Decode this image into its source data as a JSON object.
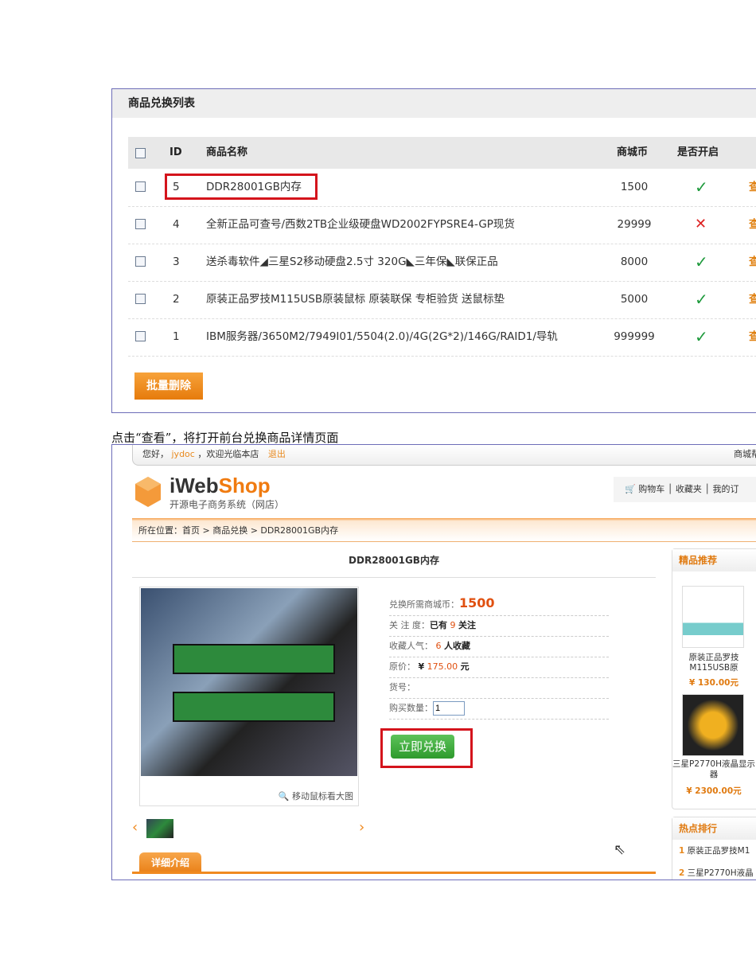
{
  "list_panel": {
    "title": "商品兑换列表",
    "columns": [
      "ID",
      "商品名称",
      "商城币",
      "是否开启"
    ],
    "rows": [
      {
        "id": "5",
        "name": "DDR28001GB内存",
        "coins": "1500",
        "enabled": true,
        "action": "查"
      },
      {
        "id": "4",
        "name": "全新正品可查号/西数2TB企业级硬盘WD2002FYPSRE4-GP现货",
        "coins": "29999",
        "enabled": false,
        "action": "查"
      },
      {
        "id": "3",
        "name": "送杀毒软件◢三星S2移动硬盘2.5寸 320G◣三年保◣联保正品",
        "coins": "8000",
        "enabled": true,
        "action": "查"
      },
      {
        "id": "2",
        "name": "原装正品罗技M115USB原装鼠标 原装联保 专柜验货 送鼠标垫",
        "coins": "5000",
        "enabled": true,
        "action": "查"
      },
      {
        "id": "1",
        "name": "IBM服务器/3650M2/7949I01/5504(2.0)/4G(2G*2)/146G/RAID1/导轨",
        "coins": "999999",
        "enabled": true,
        "action": "查"
      }
    ],
    "enabled_mark": "✓",
    "disabled_mark": "✕",
    "batch_delete": "批量删除"
  },
  "caption": "点击“查看”，将打开前台兑换商品详情页面",
  "shop": {
    "topbar": {
      "greeting": "您好，",
      "user": "jydoc",
      "welcome": "，欢迎光临本店",
      "logout": "退出",
      "right": "商城帮"
    },
    "brand_a": "iWeb",
    "brand_b": "Shop",
    "subtitle": "开源电子商务系统（网店）",
    "nav": [
      "购物车",
      "收藏夹",
      "我的订"
    ],
    "breadcrumb": "所在位置：首页 > 商品兑换 > DDR28001GB内存",
    "product_title": "DDR28001GB内存",
    "zoom_hint": "🔍 移动鼠标看大图",
    "info": {
      "coins_label": "兑换所需商城币：",
      "coins": "1500",
      "follow_label": "关 注 度：",
      "follow_pre": "已有",
      "follow": "9",
      "follow_post": "关注",
      "fav_label": "收藏人气：",
      "fav": "6",
      "fav_post": "人收藏",
      "price_label": "原价：",
      "currency": "¥",
      "price": "175.00",
      "unit": "元",
      "sku_label": "货号：",
      "qty_label": "购买数量：",
      "qty": "1"
    },
    "redeem": "立即兑换",
    "detail_tab": "详细介绍",
    "recommend": {
      "title": "精品推荐",
      "items": [
        {
          "name": "原装正品罗技M115USB原",
          "price": "¥ 130.00元"
        },
        {
          "name": "三星P2770H液晶显示器",
          "price": "¥ 2300.00元"
        }
      ]
    },
    "hot": {
      "title": "热点排行",
      "items": [
        {
          "rank": "1",
          "name": "原装正品罗技M1"
        },
        {
          "rank": "2",
          "name": "三星P2770H液晶"
        }
      ]
    }
  },
  "colors": {
    "accent": "#f07b10",
    "highlight": "#d4141c",
    "ok": "#1e9a3c"
  }
}
